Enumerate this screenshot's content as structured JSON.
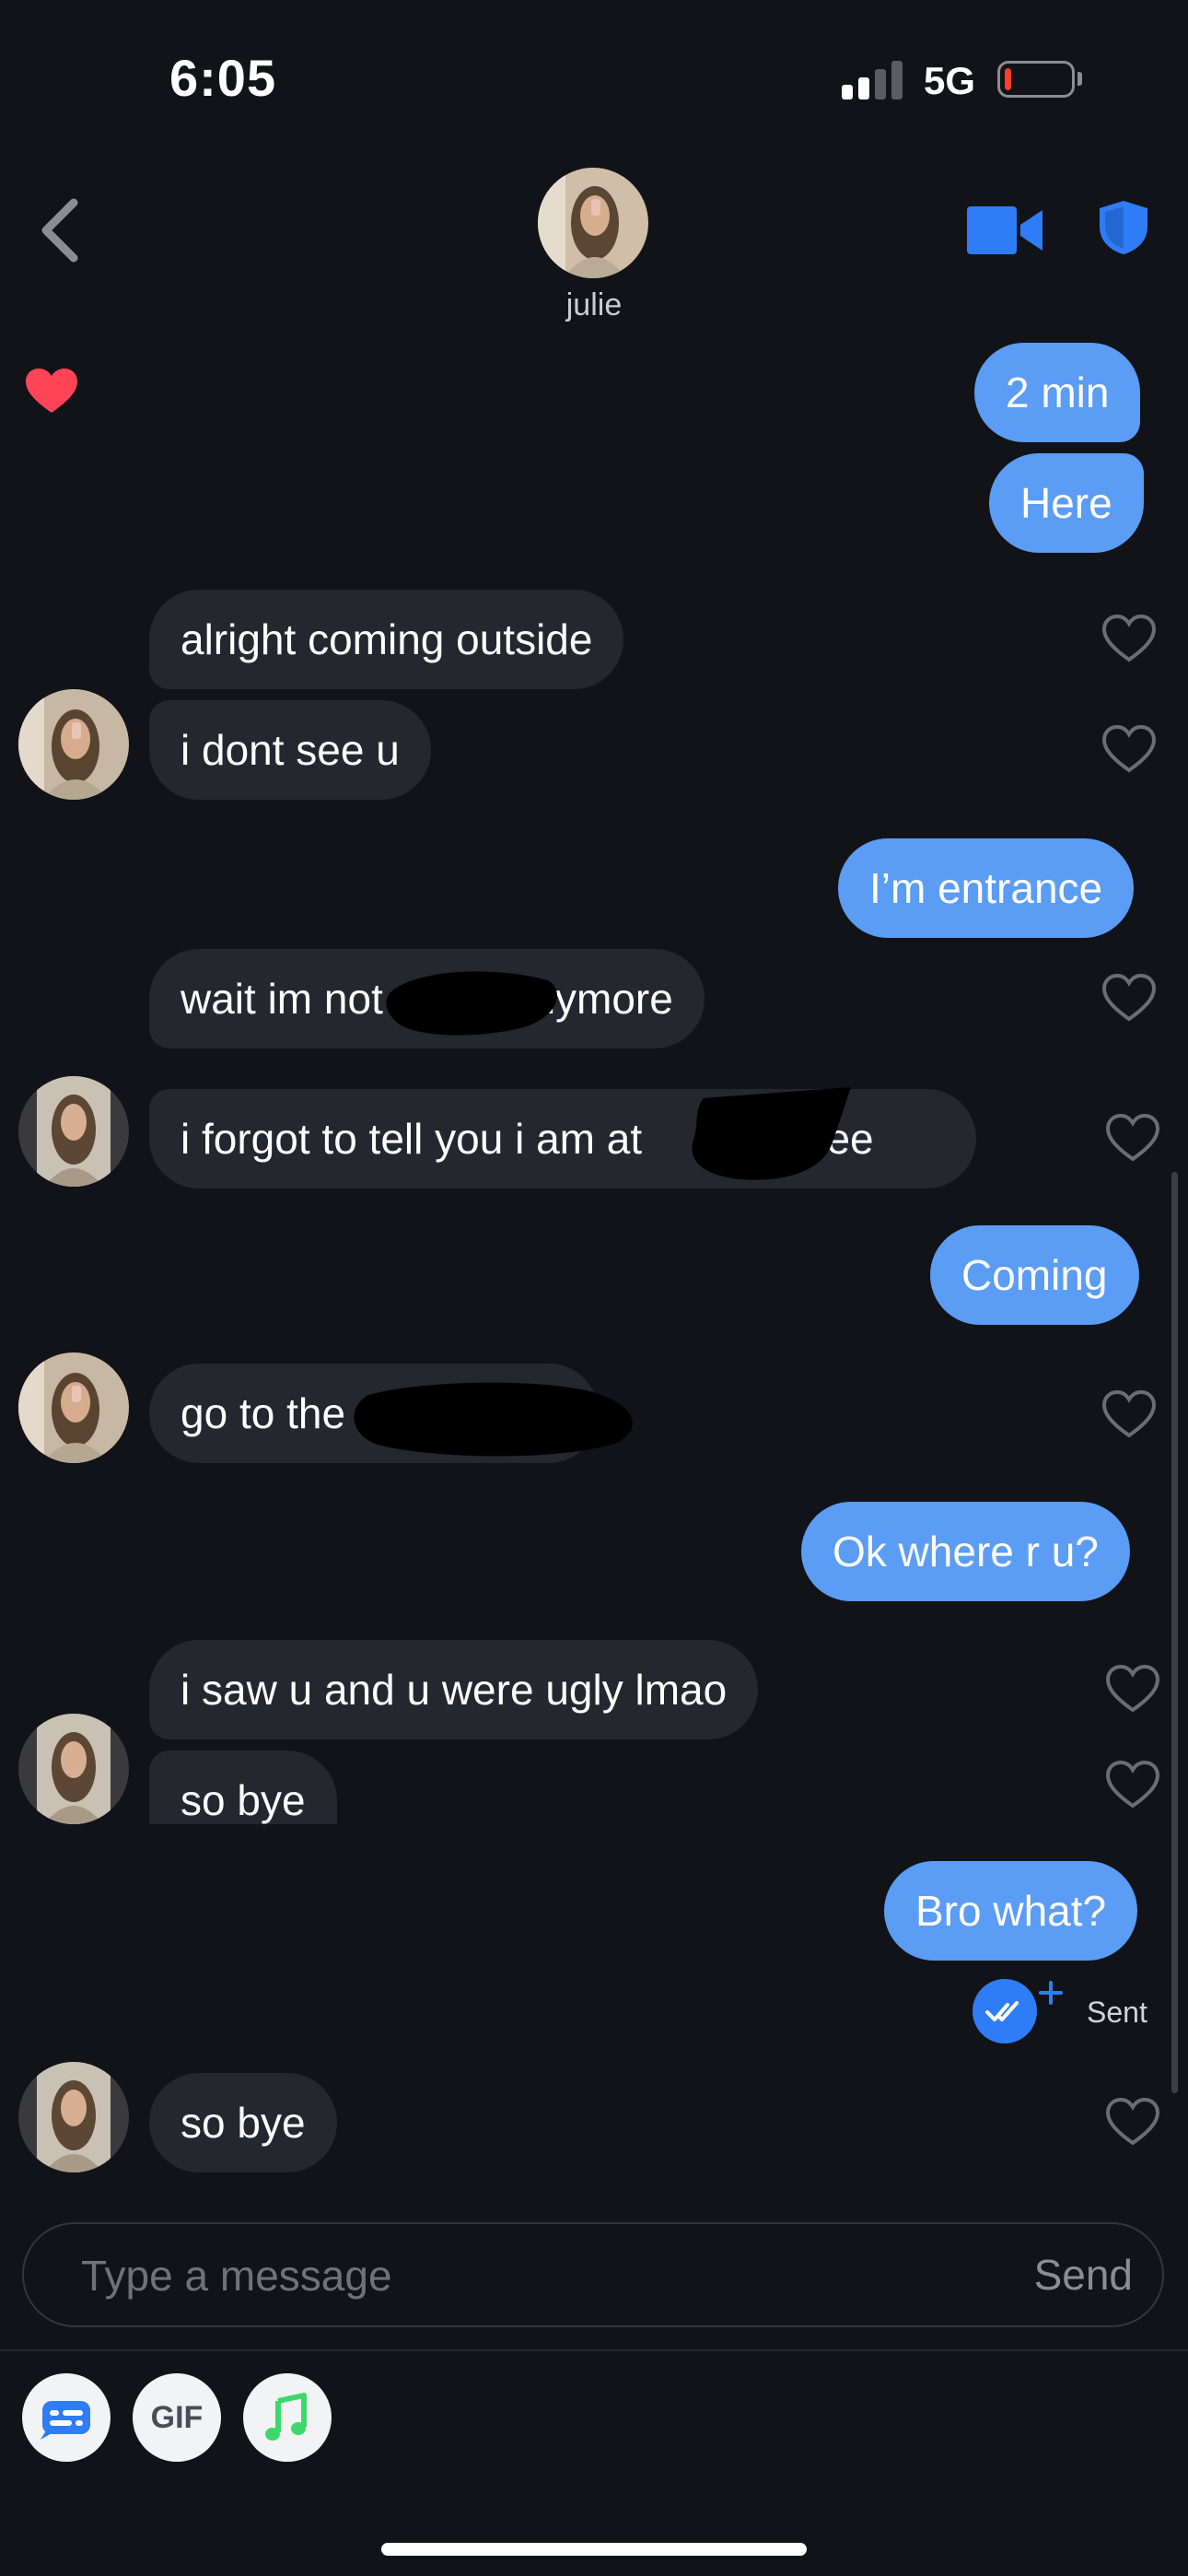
{
  "status_bar": {
    "time": "6:05",
    "network": "5G",
    "battery_level": 0.1
  },
  "header": {
    "contact_name": "julie",
    "icons": [
      "back-chevron-icon",
      "video-call-icon",
      "shield-icon"
    ]
  },
  "messages": [
    {
      "id": "m1",
      "direction": "outgoing",
      "text": "2 min"
    },
    {
      "id": "m2",
      "direction": "outgoing",
      "text": "Here"
    },
    {
      "id": "m3",
      "direction": "incoming",
      "text": "alright coming outside"
    },
    {
      "id": "m4",
      "direction": "incoming",
      "text": "i dont see u"
    },
    {
      "id": "m5",
      "direction": "outgoing",
      "text": "I’m entrance"
    },
    {
      "id": "m6",
      "direction": "incoming",
      "text_before_redaction": "wait im not",
      "text_after_redaction": "anymore"
    },
    {
      "id": "m7",
      "direction": "incoming",
      "text_before_redaction": "i forgot to tell you i am at",
      "text_after_redaction": "offee"
    },
    {
      "id": "m8",
      "direction": "outgoing",
      "text": "Coming"
    },
    {
      "id": "m9",
      "direction": "incoming",
      "text_before_redaction": "go to the"
    },
    {
      "id": "m10",
      "direction": "outgoing",
      "text": "Ok where r u?"
    },
    {
      "id": "m11",
      "direction": "incoming",
      "text": "i saw u and u were ugly lmao"
    },
    {
      "id": "m12",
      "direction": "incoming",
      "text": "so bye"
    },
    {
      "id": "m13",
      "direction": "outgoing",
      "text": "Bro what?"
    },
    {
      "id": "m14",
      "direction": "incoming",
      "text": "so bye"
    }
  ],
  "delivery": {
    "status": "Sent",
    "icons": [
      "double-check-icon",
      "plus-icon"
    ]
  },
  "composer": {
    "placeholder": "Type a message",
    "send_label": "Send"
  },
  "toolbar": {
    "gif_label": "GIF",
    "icons": [
      "sticker-icon",
      "gif-icon",
      "music-note-icon"
    ]
  },
  "colors": {
    "background": "#111318",
    "incoming_bubble": "#24272e",
    "outgoing_bubble": "#5b9cf4",
    "accent": "#2f7df6",
    "like_active": "#ff4458",
    "music_green": "#3dd86b"
  }
}
